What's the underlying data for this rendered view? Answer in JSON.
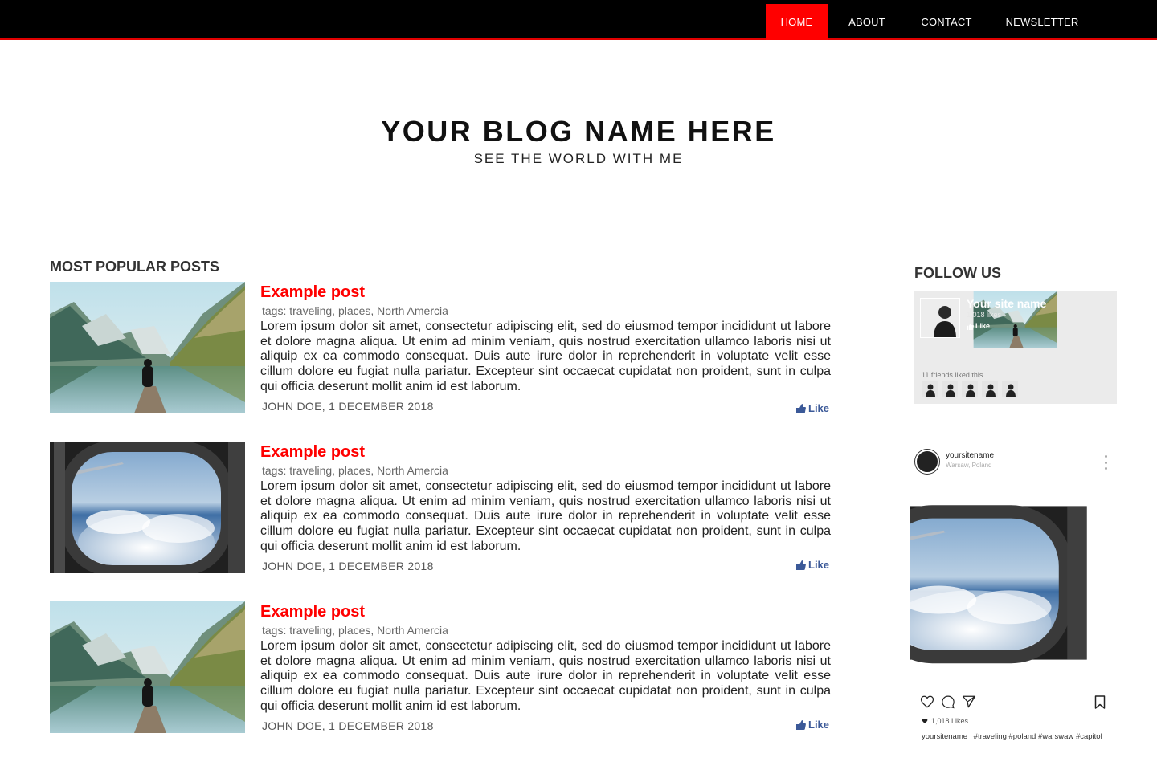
{
  "nav": {
    "items": [
      {
        "label": "HOME",
        "active": true
      },
      {
        "label": "ABOUT"
      },
      {
        "label": "CONTACT"
      },
      {
        "label": "NEWSLETTER"
      }
    ]
  },
  "header": {
    "title": "YOUR BLOG NAME HERE",
    "tagline": "SEE THE WORLD WITH ME"
  },
  "posts_section": {
    "title": "MOST POPULAR POSTS",
    "posts": [
      {
        "title": "Example post",
        "tags": "tags: traveling, places, North Amercia",
        "body": "Lorem ipsum dolor sit amet, consectetur adipiscing elit, sed do eiusmod tempor incididunt ut labore et dolore magna aliqua. Ut enim ad minim veniam, quis nostrud exercitation ullamco laboris nisi ut aliquip ex ea commodo consequat. Duis aute irure dolor in reprehenderit in voluptate velit esse cillum dolore eu fugiat nulla pariatur. Excepteur sint occaecat cupidatat non proident, sunt in culpa qui officia deserunt mollit anim id est laborum.",
        "meta": "JOHN DOE, 1 DECEMBER 2018",
        "like": "Like",
        "image": "mountain-lake"
      },
      {
        "title": "Example post",
        "tags": "tags: traveling, places, North Amercia",
        "body": "Lorem ipsum dolor sit amet, consectetur adipiscing elit, sed do eiusmod tempor incididunt ut labore et dolore magna aliqua. Ut enim ad minim veniam, quis nostrud exercitation ullamco laboris nisi ut aliquip ex ea commodo consequat. Duis aute irure dolor in reprehenderit in voluptate velit esse cillum dolore eu fugiat nulla pariatur. Excepteur sint occaecat cupidatat non proident, sunt in culpa qui officia deserunt mollit anim id est laborum.",
        "meta": "JOHN DOE, 1 DECEMBER 2018",
        "like": "Like",
        "image": "airplane-window"
      },
      {
        "title": "Example post",
        "tags": "tags: traveling, places, North Amercia",
        "body": "Lorem ipsum dolor sit amet, consectetur adipiscing elit, sed do eiusmod tempor incididunt ut labore et dolore magna aliqua. Ut enim ad minim veniam, quis nostrud exercitation ullamco laboris nisi ut aliquip ex ea commodo consequat. Duis aute irure dolor in reprehenderit in voluptate velit esse cillum dolore eu fugiat nulla pariatur. Excepteur sint occaecat cupidatat non proident, sunt in culpa qui officia deserunt mollit anim id est laborum.",
        "meta": "JOHN DOE, 1 DECEMBER 2018",
        "like": "Like",
        "image": "mountain-lake"
      }
    ]
  },
  "sidebar": {
    "title": "FOLLOW US",
    "facebook": {
      "name": "Your site name",
      "likes": "1,018 likes",
      "like_label": "Like",
      "friends_text": "11 friends liked this"
    },
    "instagram": {
      "username": "yoursitename",
      "location": "Warsaw, Poland",
      "likes": "1,018 Likes",
      "caption_user": "yoursitename",
      "caption": "#traveling #poland #warswaw #capitol"
    }
  },
  "colors": {
    "accent": "#ff0000",
    "nav_bg": "#000000",
    "facebook_blue": "#3b5998"
  },
  "icons": [
    "thumbs-up-icon",
    "heart-icon",
    "comment-icon",
    "send-icon",
    "bookmark-icon",
    "more-icon"
  ]
}
